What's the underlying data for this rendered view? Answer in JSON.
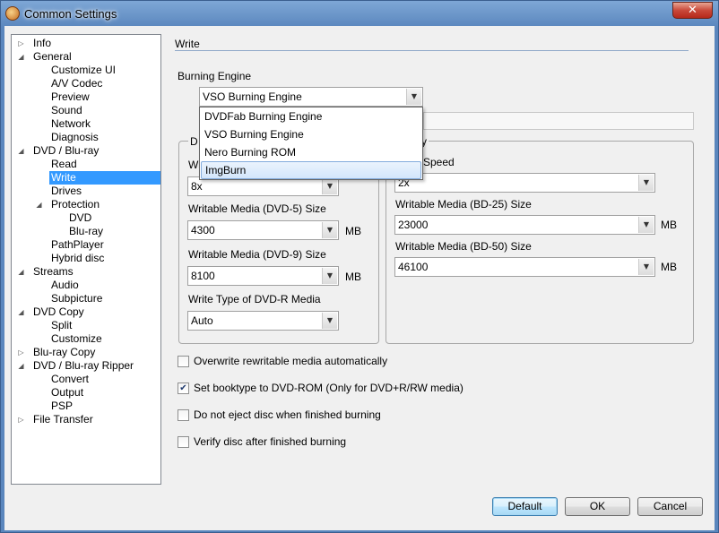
{
  "window": {
    "title": "Common Settings",
    "close_glyph": "✕"
  },
  "tree": [
    {
      "label": "Info",
      "level": 0,
      "expander": "collapsed"
    },
    {
      "label": "General",
      "level": 0,
      "expander": "expanded"
    },
    {
      "label": "Customize UI",
      "level": 1
    },
    {
      "label": "A/V Codec",
      "level": 1
    },
    {
      "label": "Preview",
      "level": 1
    },
    {
      "label": "Sound",
      "level": 1
    },
    {
      "label": "Network",
      "level": 1
    },
    {
      "label": "Diagnosis",
      "level": 1
    },
    {
      "label": "DVD / Blu-ray",
      "level": 0,
      "expander": "expanded"
    },
    {
      "label": "Read",
      "level": 1
    },
    {
      "label": "Write",
      "level": 1,
      "selected": true
    },
    {
      "label": "Drives",
      "level": 1
    },
    {
      "label": "Protection",
      "level": 1,
      "expander": "expanded"
    },
    {
      "label": "DVD",
      "level": 2
    },
    {
      "label": "Blu-ray",
      "level": 2
    },
    {
      "label": "PathPlayer",
      "level": 1
    },
    {
      "label": "Hybrid disc",
      "level": 1
    },
    {
      "label": "Streams",
      "level": 0,
      "expander": "expanded"
    },
    {
      "label": "Audio",
      "level": 1
    },
    {
      "label": "Subpicture",
      "level": 1
    },
    {
      "label": "DVD Copy",
      "level": 0,
      "expander": "expanded"
    },
    {
      "label": "Split",
      "level": 1
    },
    {
      "label": "Customize",
      "level": 1
    },
    {
      "label": "Blu-ray Copy",
      "level": 0,
      "expander": "collapsed"
    },
    {
      "label": "DVD / Blu-ray Ripper",
      "level": 0,
      "expander": "expanded"
    },
    {
      "label": "Convert",
      "level": 1
    },
    {
      "label": "Output",
      "level": 1
    },
    {
      "label": "PSP",
      "level": 1
    },
    {
      "label": "File Transfer",
      "level": 0,
      "expander": "collapsed"
    }
  ],
  "section": {
    "title": "Write"
  },
  "engine": {
    "label": "Burning Engine",
    "value": "VSO Burning Engine",
    "options": [
      "DVDFab Burning Engine",
      "VSO Burning Engine",
      "Nero Burning ROM",
      "ImgBurn"
    ],
    "highlighted_option": "ImgBurn"
  },
  "dvd_group": {
    "title_fragment": "D",
    "speed_label_fragment": "Wr",
    "speed_value": "8x",
    "dvd5_label": "Writable Media (DVD-5) Size",
    "dvd5_value": "4300",
    "dvd9_label": "Writable Media (DVD-9) Size",
    "dvd9_value": "8100",
    "type_label": "Write Type of DVD-R Media",
    "type_value": "Auto",
    "unit": "MB"
  },
  "bd_group": {
    "title_fragment": "y",
    "speed_label_fragment": "Speed",
    "speed_value": "2x",
    "bd25_label": "Writable Media (BD-25) Size",
    "bd25_value": "23000",
    "bd50_label": "Writable Media (BD-50) Size",
    "bd50_value": "46100",
    "unit": "MB"
  },
  "options": [
    {
      "label": "Overwrite rewritable media automatically",
      "checked": false
    },
    {
      "label": "Set booktype to DVD-ROM (Only for DVD+R/RW media)",
      "checked": true
    },
    {
      "label": "Do not eject disc when finished burning",
      "checked": false
    },
    {
      "label": "Verify disc after finished burning",
      "checked": false
    }
  ],
  "buttons": {
    "default": "Default",
    "ok": "OK",
    "cancel": "Cancel"
  },
  "icons": {
    "expanded": "◢",
    "collapsed": "▷",
    "dropdown": "▼",
    "check": "✔"
  }
}
